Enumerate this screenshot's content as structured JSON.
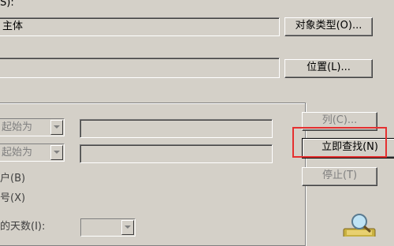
{
  "object_type_field": {
    "label_fragment": "S):",
    "value": "主体",
    "button": "对象类型(O)..."
  },
  "location_field": {
    "value": "",
    "button": "位置(L)..."
  },
  "query_group": {
    "rows": [
      {
        "combo": "起始为",
        "value": ""
      },
      {
        "combo": "起始为",
        "value": ""
      }
    ],
    "checkbox_fragments": [
      "户(B)",
      "号(X)"
    ],
    "days_label": "的天数(I):"
  },
  "side_buttons": {
    "columns": "列(C)...",
    "find_now": "立即查找(N)",
    "stop": "停止(T)"
  },
  "colors": {
    "dialog_bg": "#d4d0c8",
    "highlight": "#e53030"
  },
  "icons": {
    "search": "magnifier-icon"
  }
}
